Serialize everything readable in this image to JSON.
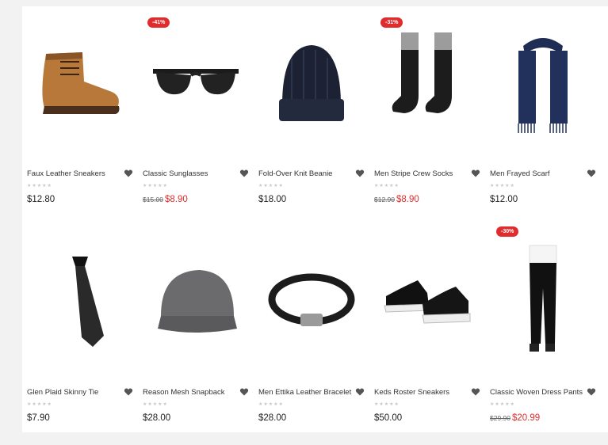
{
  "products": [
    {
      "name": "Faux Leather Sneakers",
      "stars": "★★★★★",
      "price": "$12.80",
      "old_price": "",
      "sale_price": "",
      "badge": ""
    },
    {
      "name": "Classic Sunglasses",
      "stars": "★★★★★",
      "price": "",
      "old_price": "$15.00",
      "sale_price": "$8.90",
      "badge": "-41%"
    },
    {
      "name": "Fold-Over Knit Beanie",
      "stars": "★★★★★",
      "price": "$18.00",
      "old_price": "",
      "sale_price": "",
      "badge": ""
    },
    {
      "name": "Men Stripe Crew Socks",
      "stars": "★★★★★",
      "price": "",
      "old_price": "$12.90",
      "sale_price": "$8.90",
      "badge": "-31%"
    },
    {
      "name": "Men Frayed Scarf",
      "stars": "★★★★★",
      "price": "$12.00",
      "old_price": "",
      "sale_price": "",
      "badge": ""
    },
    {
      "name": "Glen Plaid Skinny Tie",
      "stars": "★★★★★",
      "price": "$7.90",
      "old_price": "",
      "sale_price": "",
      "badge": ""
    },
    {
      "name": "Reason Mesh Snapback",
      "stars": "★★★★★",
      "price": "$28.00",
      "old_price": "",
      "sale_price": "",
      "badge": ""
    },
    {
      "name": "Men Ettika Leather Bracelet",
      "stars": "★★★★★",
      "price": "$28.00",
      "old_price": "",
      "sale_price": "",
      "badge": ""
    },
    {
      "name": "Keds Roster Sneakers",
      "stars": "★★★★★",
      "price": "$50.00",
      "old_price": "",
      "sale_price": "",
      "badge": ""
    },
    {
      "name": "Classic Woven Dress Pants",
      "stars": "★★★★★",
      "price": "",
      "old_price": "$29.90",
      "sale_price": "$20.99",
      "badge": "-30%"
    }
  ]
}
